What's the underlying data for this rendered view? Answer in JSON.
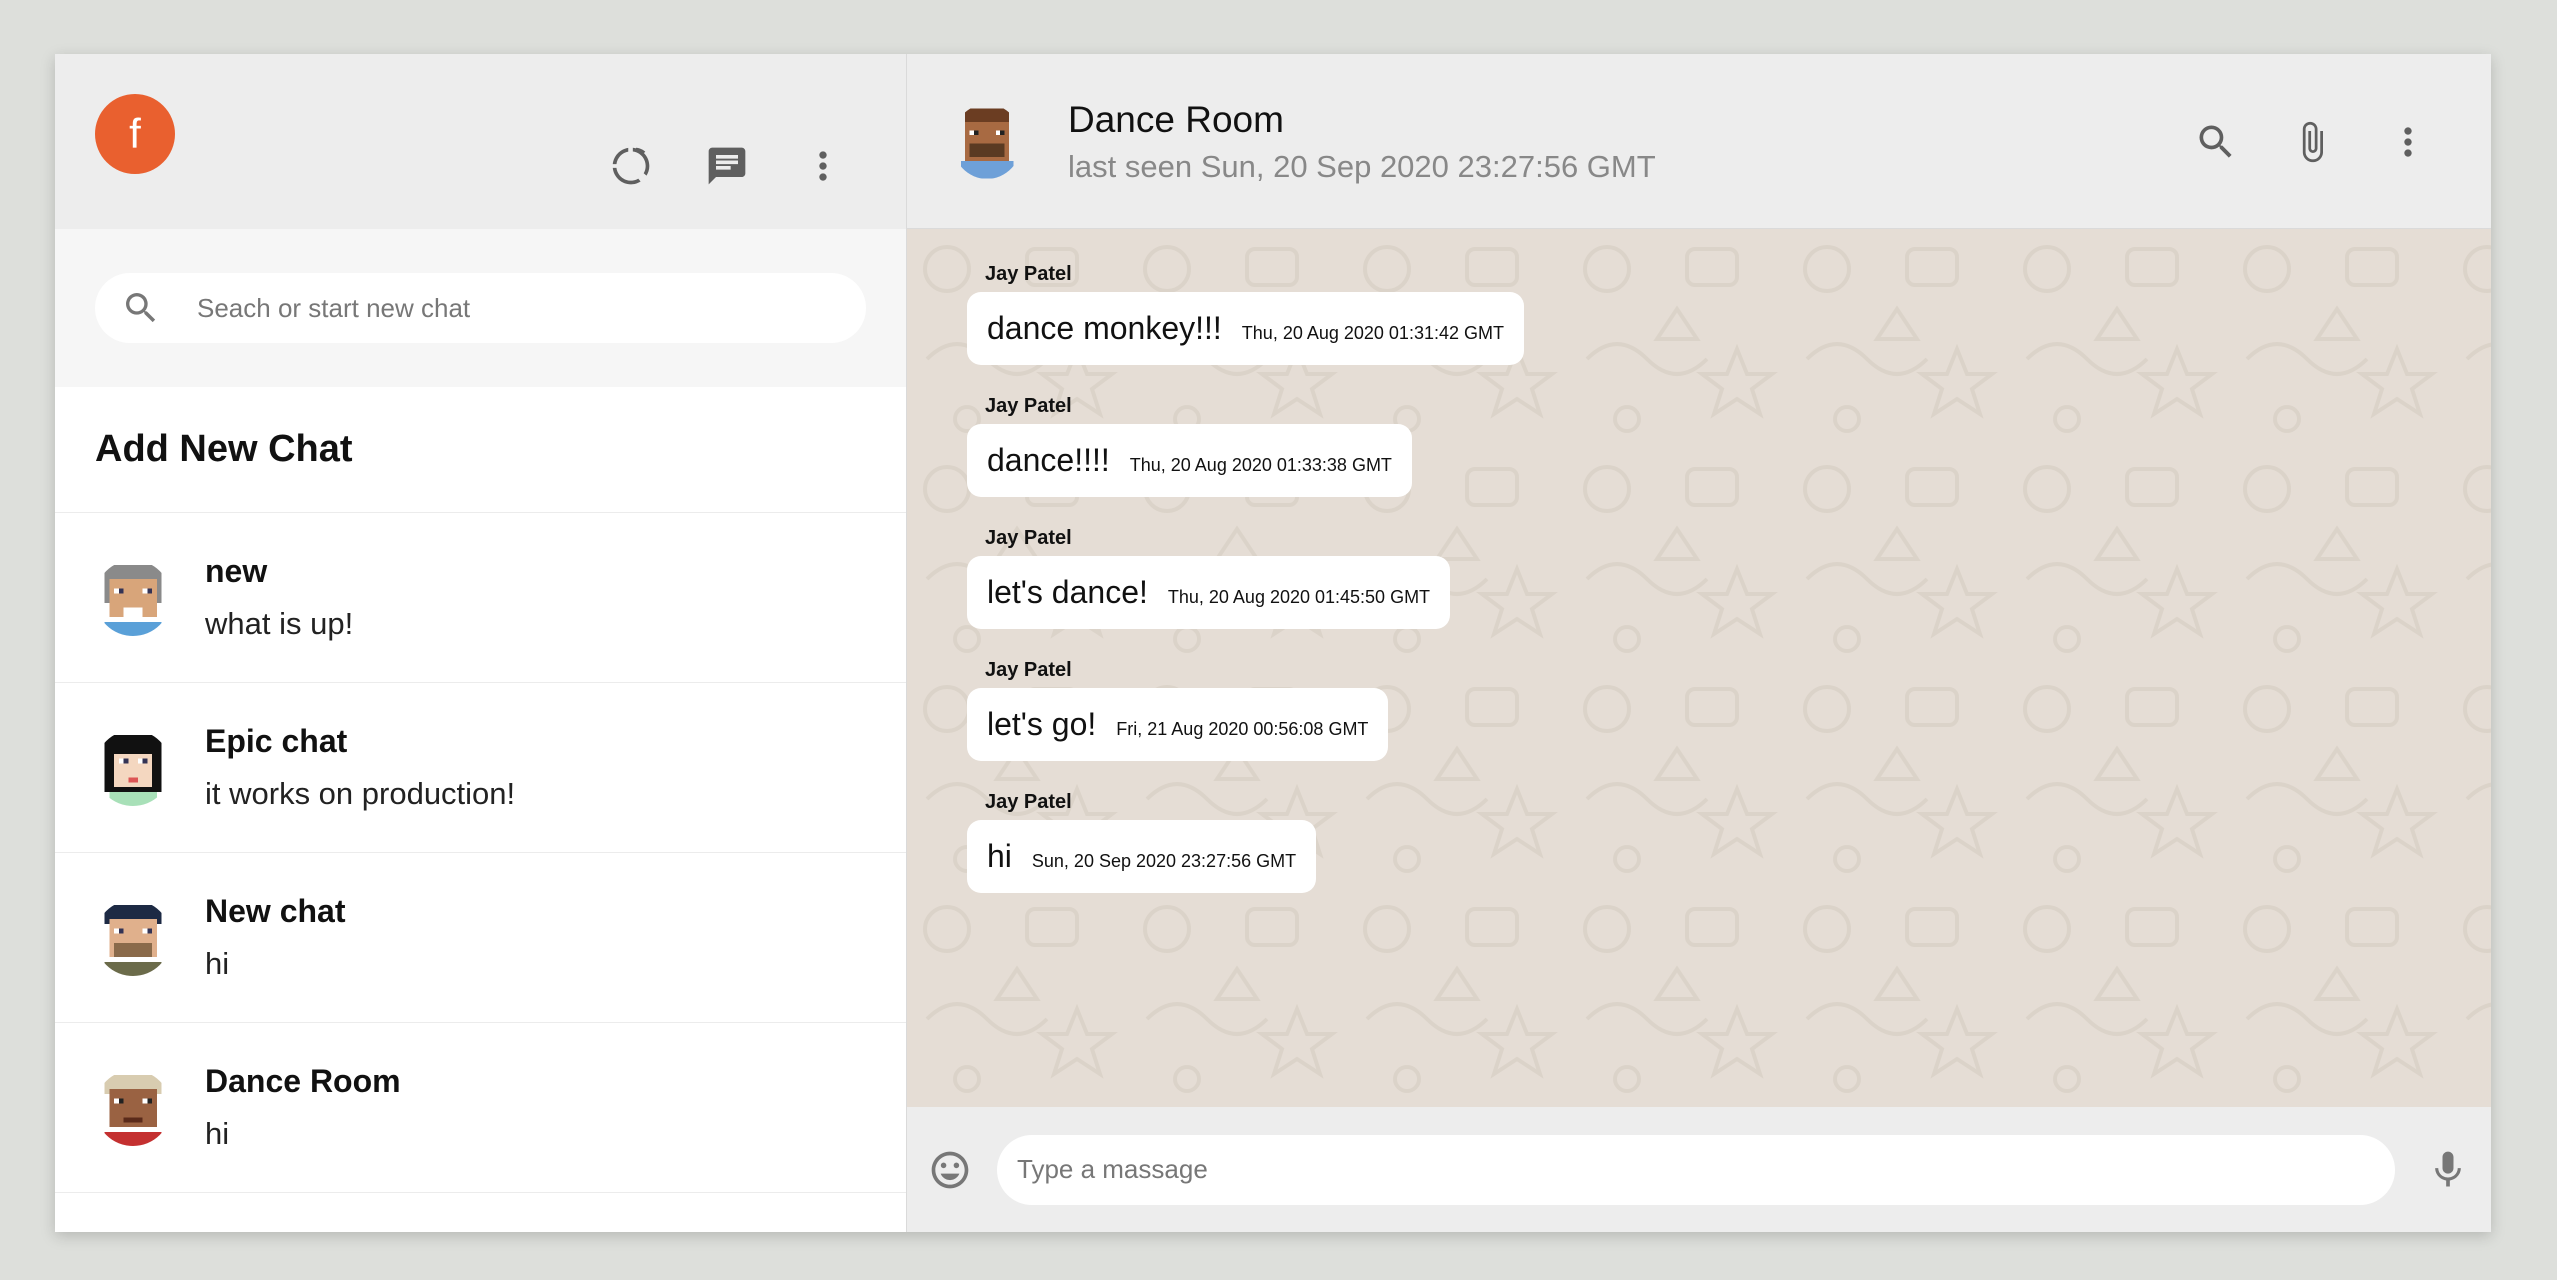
{
  "sidebar": {
    "user_initial": "f",
    "icons": [
      "status-icon",
      "new-chat-icon",
      "more-vert-icon"
    ],
    "search_placeholder": "Seach or start new chat",
    "add_new_chat": "Add New Chat",
    "chats": [
      {
        "name": "new",
        "last_message": "what is up!"
      },
      {
        "name": "Epic chat",
        "last_message": "it works on production!"
      },
      {
        "name": "New chat",
        "last_message": "hi"
      },
      {
        "name": "Dance Room",
        "last_message": "hi"
      }
    ]
  },
  "chat": {
    "room_name": "Dance Room",
    "last_seen": "last seen Sun, 20 Sep 2020 23:27:56 GMT",
    "header_icons": [
      "search-icon",
      "attach-icon",
      "more-vert-icon"
    ],
    "messages": [
      {
        "sender": "Jay Patel",
        "text": "dance monkey!!!",
        "time": "Thu, 20 Aug 2020 01:31:42 GMT"
      },
      {
        "sender": "Jay Patel",
        "text": "dance!!!!",
        "time": "Thu, 20 Aug 2020 01:33:38 GMT"
      },
      {
        "sender": "Jay Patel",
        "text": "let's dance!",
        "time": "Thu, 20 Aug 2020 01:45:50 GMT"
      },
      {
        "sender": "Jay Patel",
        "text": "let's go!",
        "time": "Fri, 21 Aug 2020 00:56:08 GMT"
      },
      {
        "sender": "Jay Patel",
        "text": "hi",
        "time": "Sun, 20 Sep 2020 23:27:56 GMT"
      }
    ],
    "input_placeholder": "Type a massage"
  },
  "colors": {
    "accent_avatar": "#e9602f",
    "header_bg": "#ededed",
    "chat_bg": "#e5ddd5"
  }
}
